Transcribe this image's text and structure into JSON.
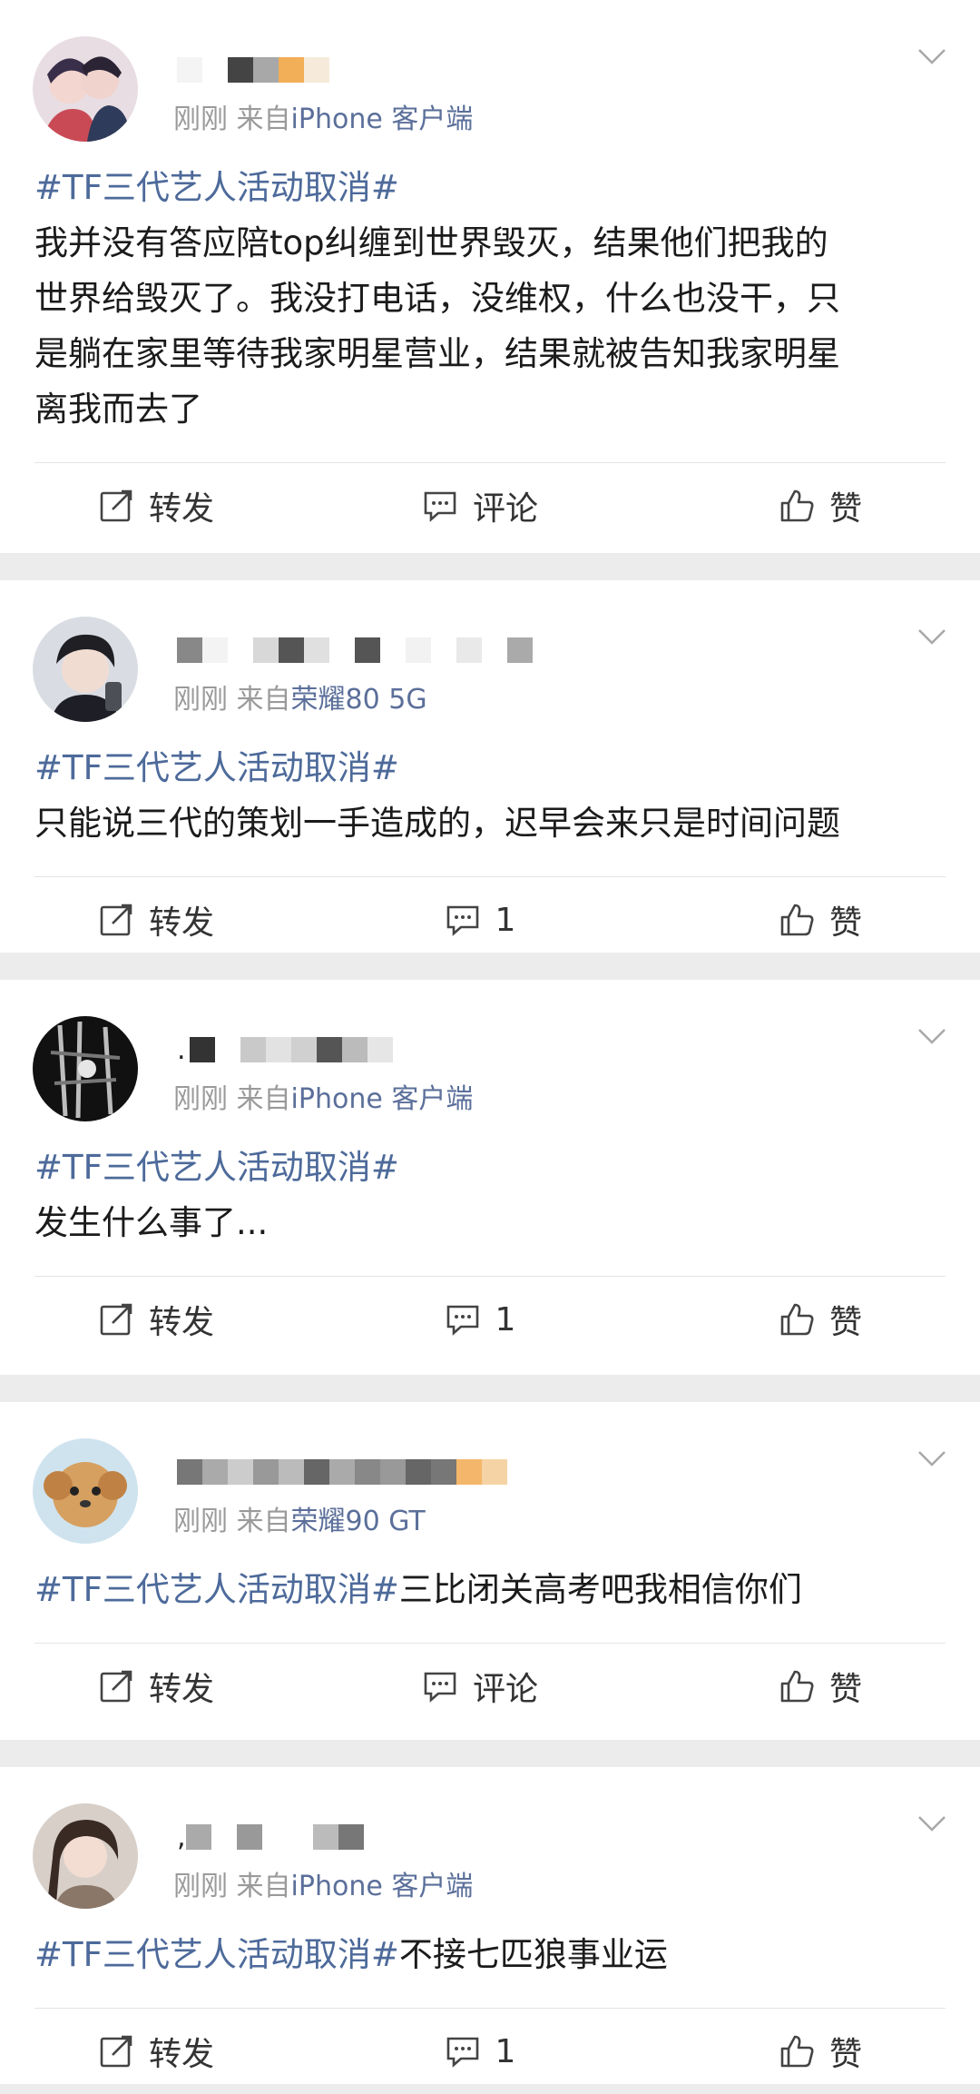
{
  "colors": {
    "link": "#4d6a9a",
    "meta": "#9a9a9a",
    "background": "#ececec"
  },
  "posts": [
    {
      "time": "刚刚",
      "source_prefix": "来自",
      "device": "iPhone 客户端",
      "hashtag": "#TF三代艺人活动取消#",
      "text_lines": [
        "我并没有答应陪top纠缠到世界毁灭，结果他们把我的",
        "世界给毁灭了。我没打电话，没维权，什么也没干，只",
        "是躺在家里等待我家明星营业，结果就被告知我家明星",
        "离我而去了"
      ],
      "inline": false,
      "repost_label": "转发",
      "comment_label": "评论",
      "like_label": "赞"
    },
    {
      "time": "刚刚",
      "source_prefix": "来自",
      "device": "荣耀80 5G",
      "hashtag": "#TF三代艺人活动取消#",
      "text_lines": [
        "只能说三代的策划一手造成的，迟早会来只是时间问题"
      ],
      "inline": false,
      "repost_label": "转发",
      "comment_label": "1",
      "like_label": "赞"
    },
    {
      "time": "刚刚",
      "source_prefix": "来自",
      "device": "iPhone 客户端",
      "hashtag": "#TF三代艺人活动取消#",
      "text_lines": [
        "发生什么事了..."
      ],
      "inline": false,
      "repost_label": "转发",
      "comment_label": "1",
      "like_label": "赞"
    },
    {
      "time": "刚刚",
      "source_prefix": "来自",
      "device": "荣耀90 GT",
      "hashtag": "#TF三代艺人活动取消#",
      "text_lines": [
        "三比闭关高考吧我相信你们"
      ],
      "inline": true,
      "repost_label": "转发",
      "comment_label": "评论",
      "like_label": "赞"
    },
    {
      "time": "刚刚",
      "source_prefix": "来自",
      "device": "iPhone 客户端",
      "hashtag": "#TF三代艺人活动取消#",
      "text_lines": [
        "不接七匹狼事业运"
      ],
      "inline": true,
      "repost_label": "转发",
      "comment_label": "1",
      "like_label": "赞"
    }
  ]
}
